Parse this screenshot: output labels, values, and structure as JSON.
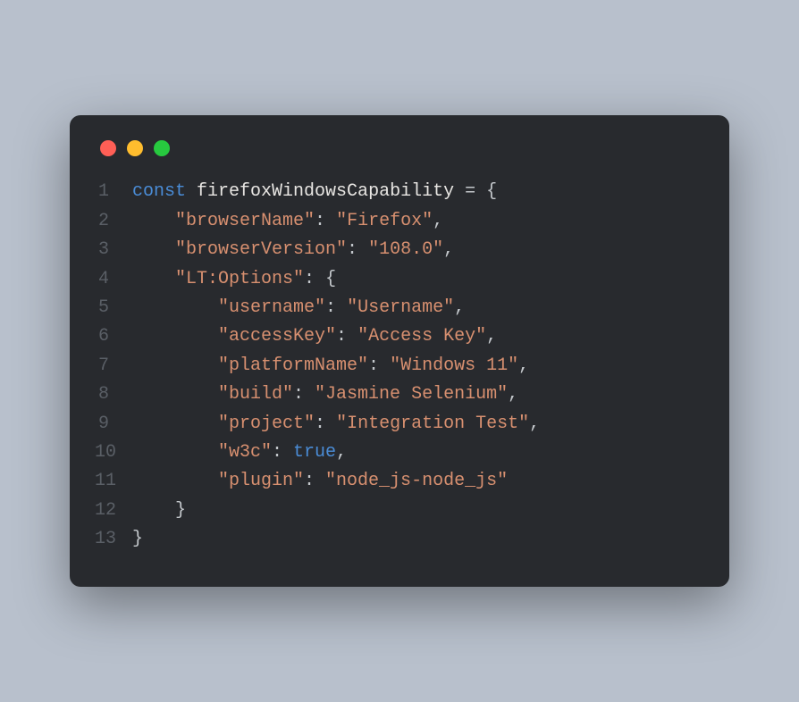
{
  "window": {
    "traffic_lights": {
      "close_color": "#ff5f56",
      "minimize_color": "#ffbd2e",
      "zoom_color": "#27c93f"
    }
  },
  "code": {
    "keyword_const": "const",
    "var_name": "firefoxWindowsCapability",
    "equals": " = ",
    "brace_open": "{",
    "brace_close": "}",
    "comma": ",",
    "colon": ": ",
    "keys": {
      "browserName": "\"browserName\"",
      "browserVersion": "\"browserVersion\"",
      "ltOptions": "\"LT:Options\"",
      "username": "\"username\"",
      "accessKey": "\"accessKey\"",
      "platformName": "\"platformName\"",
      "build": "\"build\"",
      "project": "\"project\"",
      "w3c": "\"w3c\"",
      "plugin": "\"plugin\""
    },
    "values": {
      "browserName": "\"Firefox\"",
      "browserVersion": "\"108.0\"",
      "username": "\"Username\"",
      "accessKey": "\"Access Key\"",
      "platformName": "\"Windows 11\"",
      "build": "\"Jasmine Selenium\"",
      "project": "\"Integration Test\"",
      "w3c": "true",
      "plugin": "\"node_js-node_js\""
    },
    "indent1": "    ",
    "indent2": "        ",
    "line_numbers": [
      "1",
      "2",
      "3",
      "4",
      "5",
      "6",
      "7",
      "8",
      "9",
      "10",
      "11",
      "12",
      "13"
    ]
  }
}
